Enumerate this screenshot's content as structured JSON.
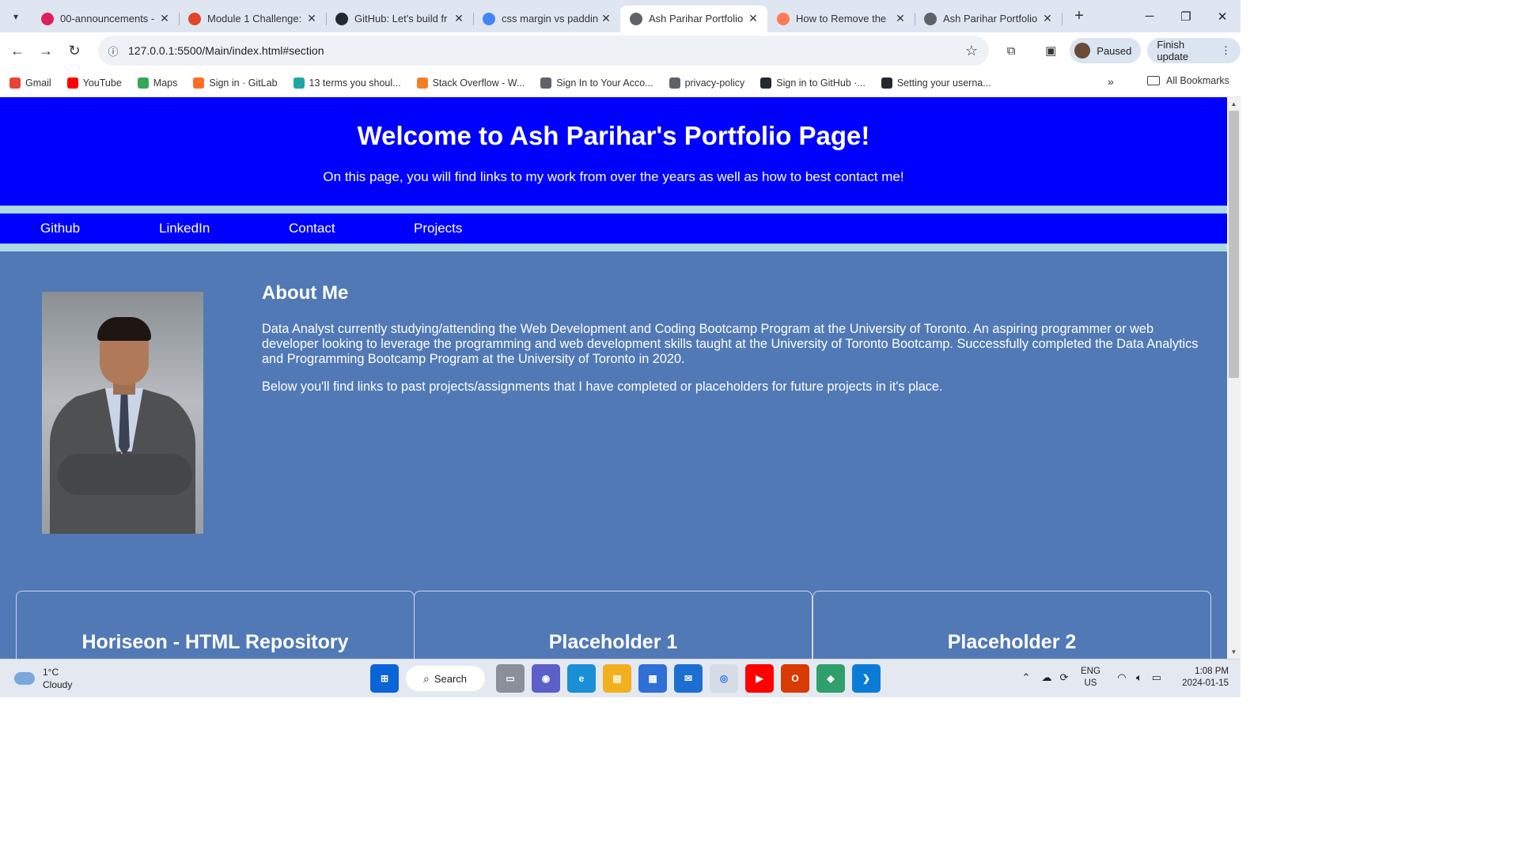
{
  "browser": {
    "tabs": [
      {
        "title": "00-announcements -",
        "icon": "slack-icon",
        "color": "#e01e5a"
      },
      {
        "title": "Module 1 Challenge:",
        "icon": "gitlab-icon",
        "color": "#e24329"
      },
      {
        "title": "GitHub: Let's build fr",
        "icon": "github-icon",
        "color": "#24292f"
      },
      {
        "title": "css margin vs paddin",
        "icon": "google-icon",
        "color": "#4285f4"
      },
      {
        "title": "Ash Parihar Portfolio",
        "icon": "globe-icon",
        "color": "#5f6368",
        "active": true
      },
      {
        "title": "How to Remove the",
        "icon": "hubspot-icon",
        "color": "#ff7a59"
      },
      {
        "title": "Ash Parihar Portfolio",
        "icon": "globe-icon",
        "color": "#5f6368"
      }
    ],
    "url": "127.0.0.1:5500/Main/index.html#section",
    "profile_label": "Paused",
    "finish_update_label": "Finish update",
    "bookmarks": [
      {
        "label": "Gmail",
        "icon": "gmail-icon",
        "color": "#ea4335"
      },
      {
        "label": "YouTube",
        "icon": "youtube-icon",
        "color": "#ff0000"
      },
      {
        "label": "Maps",
        "icon": "maps-icon",
        "color": "#34a853"
      },
      {
        "label": "Sign in · GitLab",
        "icon": "gitlab-icon",
        "color": "#fc6d26"
      },
      {
        "label": "13 terms you shoul...",
        "icon": "bookmark-h-icon",
        "color": "#1fa7a3"
      },
      {
        "label": "Stack Overflow - W...",
        "icon": "stackoverflow-icon",
        "color": "#f48024"
      },
      {
        "label": "Sign In to Your Acco...",
        "icon": "globe-icon",
        "color": "#5f6368"
      },
      {
        "label": "privacy-policy",
        "icon": "globe-icon",
        "color": "#5f6368"
      },
      {
        "label": "Sign in to GitHub ·...",
        "icon": "github-icon",
        "color": "#24292f"
      },
      {
        "label": "Setting your userna...",
        "icon": "github-icon",
        "color": "#24292f"
      }
    ],
    "all_bookmarks_label": "All Bookmarks"
  },
  "page": {
    "header_title": "Welcome to Ash Parihar's Portfolio Page!",
    "header_subtitle": "On this page, you will find links to my work from over the years as well as how to best contact me!",
    "nav": [
      "Github",
      "LinkedIn",
      "Contact",
      "Projects"
    ],
    "about_title": "About Me",
    "about_p1": "Data Analyst currently studying/attending the Web Development and Coding Bootcamp Program at the University of Toronto. An aspiring programmer or web developer looking to leverage the programming and web development skills taught at the University of Toronto Bootcamp. Successfully completed the Data Analytics and Programming Bootcamp Program at the University of Toronto in 2020.",
    "about_p2": "Below you'll find links to past projects/assignments that I have completed or placeholders for future projects in it's place.",
    "cards": [
      "Horiseon - HTML Repository",
      "Placeholder 1",
      "Placeholder 2"
    ],
    "colors": {
      "header_bg": "#0000ff",
      "stripe": "#add8e6",
      "body_bg": "#5179b5"
    }
  },
  "taskbar": {
    "temperature": "1°C",
    "weather": "Cloudy",
    "search_label": "Search",
    "lang_top": "ENG",
    "lang_bottom": "US",
    "time": "1:08 PM",
    "date": "2024-01-15"
  }
}
